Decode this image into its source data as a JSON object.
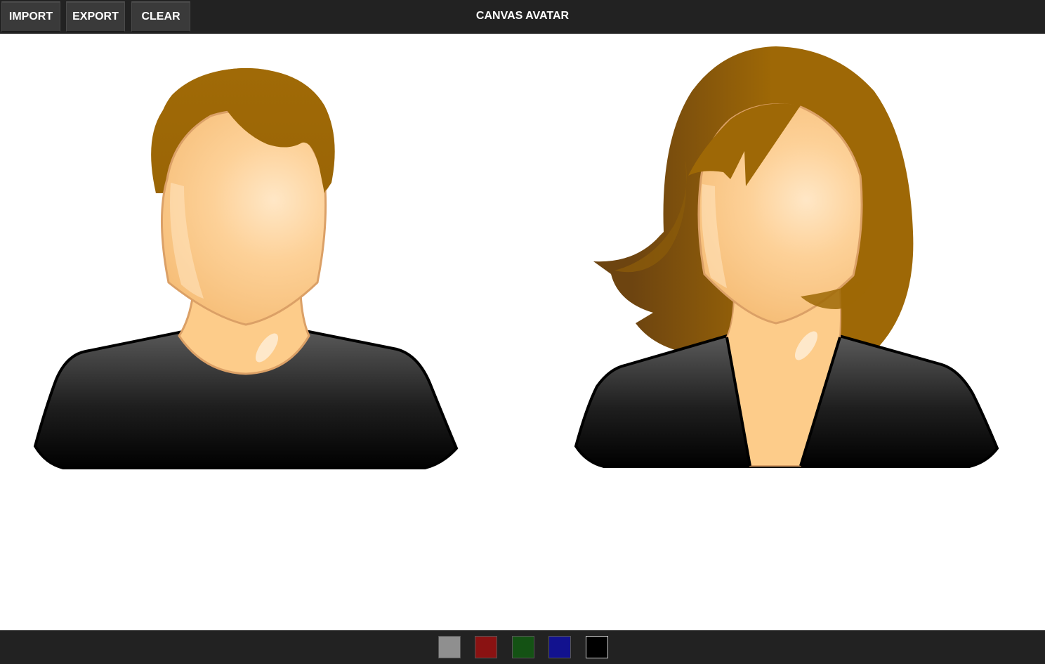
{
  "toolbar": {
    "import_label": "IMPORT",
    "export_label": "EXPORT",
    "clear_label": "CLEAR"
  },
  "app_title": "CANVAS AVATAR",
  "avatars": [
    {
      "kind": "male",
      "hair_color": "#9e6806",
      "skin_color": "#fdcc8a",
      "shirt_color": "#000000"
    },
    {
      "kind": "female",
      "hair_color": "#9e6806",
      "skin_color": "#fdcc8a",
      "shirt_color": "#000000"
    }
  ],
  "palette": {
    "colors": [
      "#8f8f8f",
      "#8a1212",
      "#145214",
      "#12128f",
      "#000000"
    ]
  }
}
